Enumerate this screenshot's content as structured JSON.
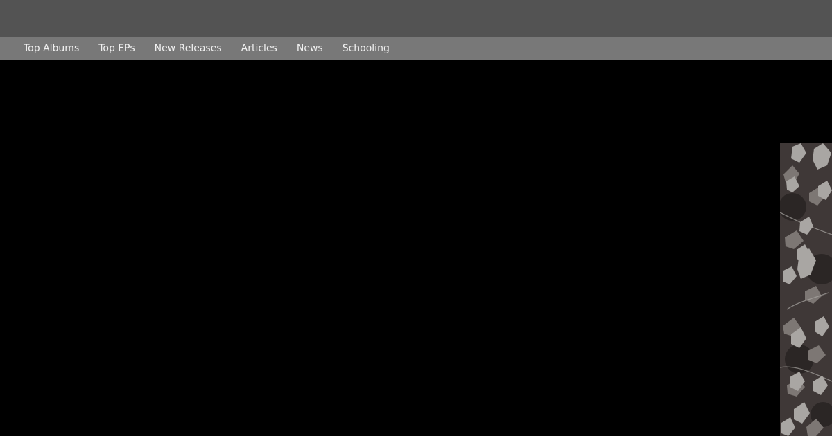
{
  "nav": {
    "items": [
      {
        "label": "Top Albums"
      },
      {
        "label": "Top EPs"
      },
      {
        "label": "New Releases"
      },
      {
        "label": "Articles"
      },
      {
        "label": "News"
      },
      {
        "label": "Schooling"
      }
    ]
  },
  "colors": {
    "top_bar": "#535353",
    "nav_bar": "#787878",
    "nav_text": "#f0f0f0",
    "background": "#000000",
    "image_base": "#3f3837",
    "leaf_light": "#a9a6a3",
    "leaf_mid": "#7d7774",
    "leaf_dark": "#2b2625"
  }
}
